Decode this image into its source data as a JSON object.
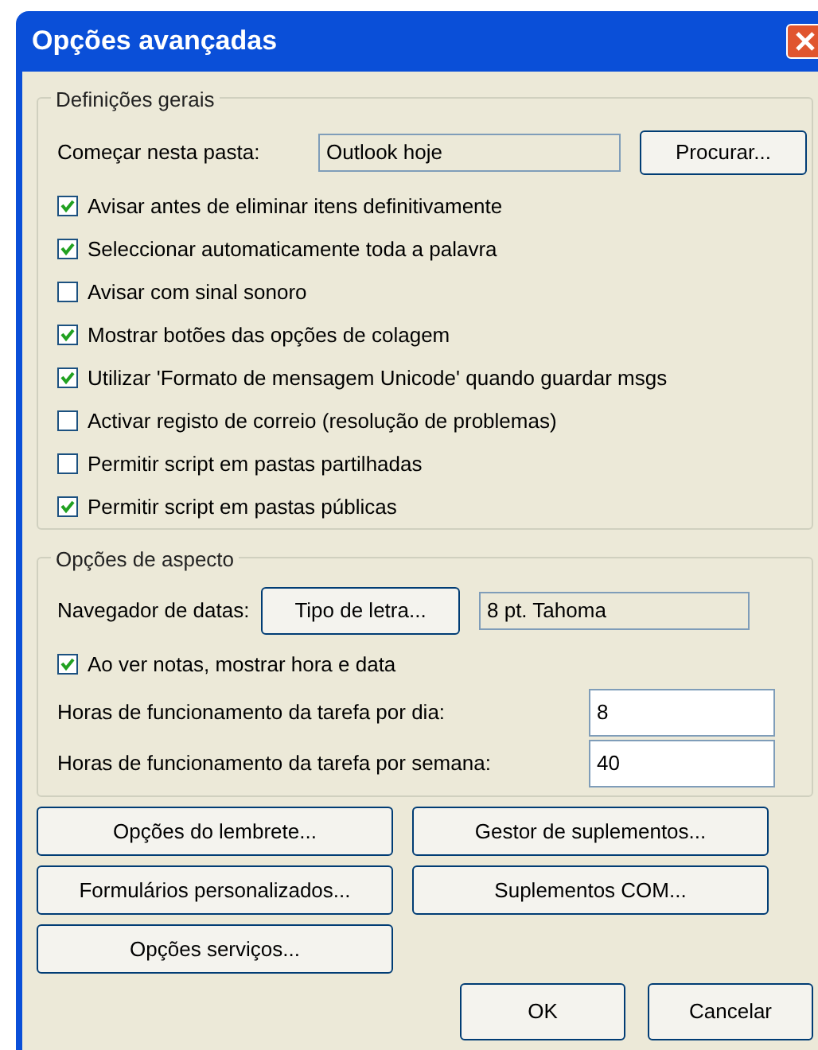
{
  "window": {
    "title": "Opções avançadas"
  },
  "general": {
    "title": "Definições gerais",
    "start_folder": {
      "label": "Começar nesta pasta:",
      "value": "Outlook hoje",
      "button": "Procurar..."
    },
    "options": [
      {
        "label": "Avisar antes de eliminar itens definitivamente",
        "checked": true
      },
      {
        "label": "Seleccionar automaticamente toda a palavra",
        "checked": true
      },
      {
        "label": "Avisar com sinal sonoro",
        "checked": false
      },
      {
        "label": "Mostrar botões das opções de colagem",
        "checked": true
      },
      {
        "label": "Utilizar 'Formato de mensagem Unicode' quando guardar msgs",
        "checked": true
      },
      {
        "label": "Activar registo de correio (resolução de problemas)",
        "checked": false
      },
      {
        "label": "Permitir script em pastas partilhadas",
        "checked": false
      },
      {
        "label": "Permitir script em pastas públicas",
        "checked": true
      }
    ]
  },
  "appearance": {
    "title": "Opções de aspecto",
    "date_navigator": {
      "label": "Navegador de datas:",
      "button": "Tipo de letra...",
      "value": "8 pt. Tahoma"
    },
    "notes_option": {
      "label": "Ao ver notas, mostrar hora e data",
      "checked": true
    },
    "fields": [
      {
        "label": "Horas de funcionamento da tarefa por dia:",
        "value": "8"
      },
      {
        "label": "Horas de funcionamento da tarefa por semana:",
        "value": "40"
      }
    ]
  },
  "buttons": [
    "Opções do lembrete...",
    "Gestor de suplementos...",
    "Formulários personalizados...",
    "Suplementos COM...",
    "Opções serviços..."
  ],
  "dialog_buttons": [
    "OK",
    "Cancelar"
  ]
}
